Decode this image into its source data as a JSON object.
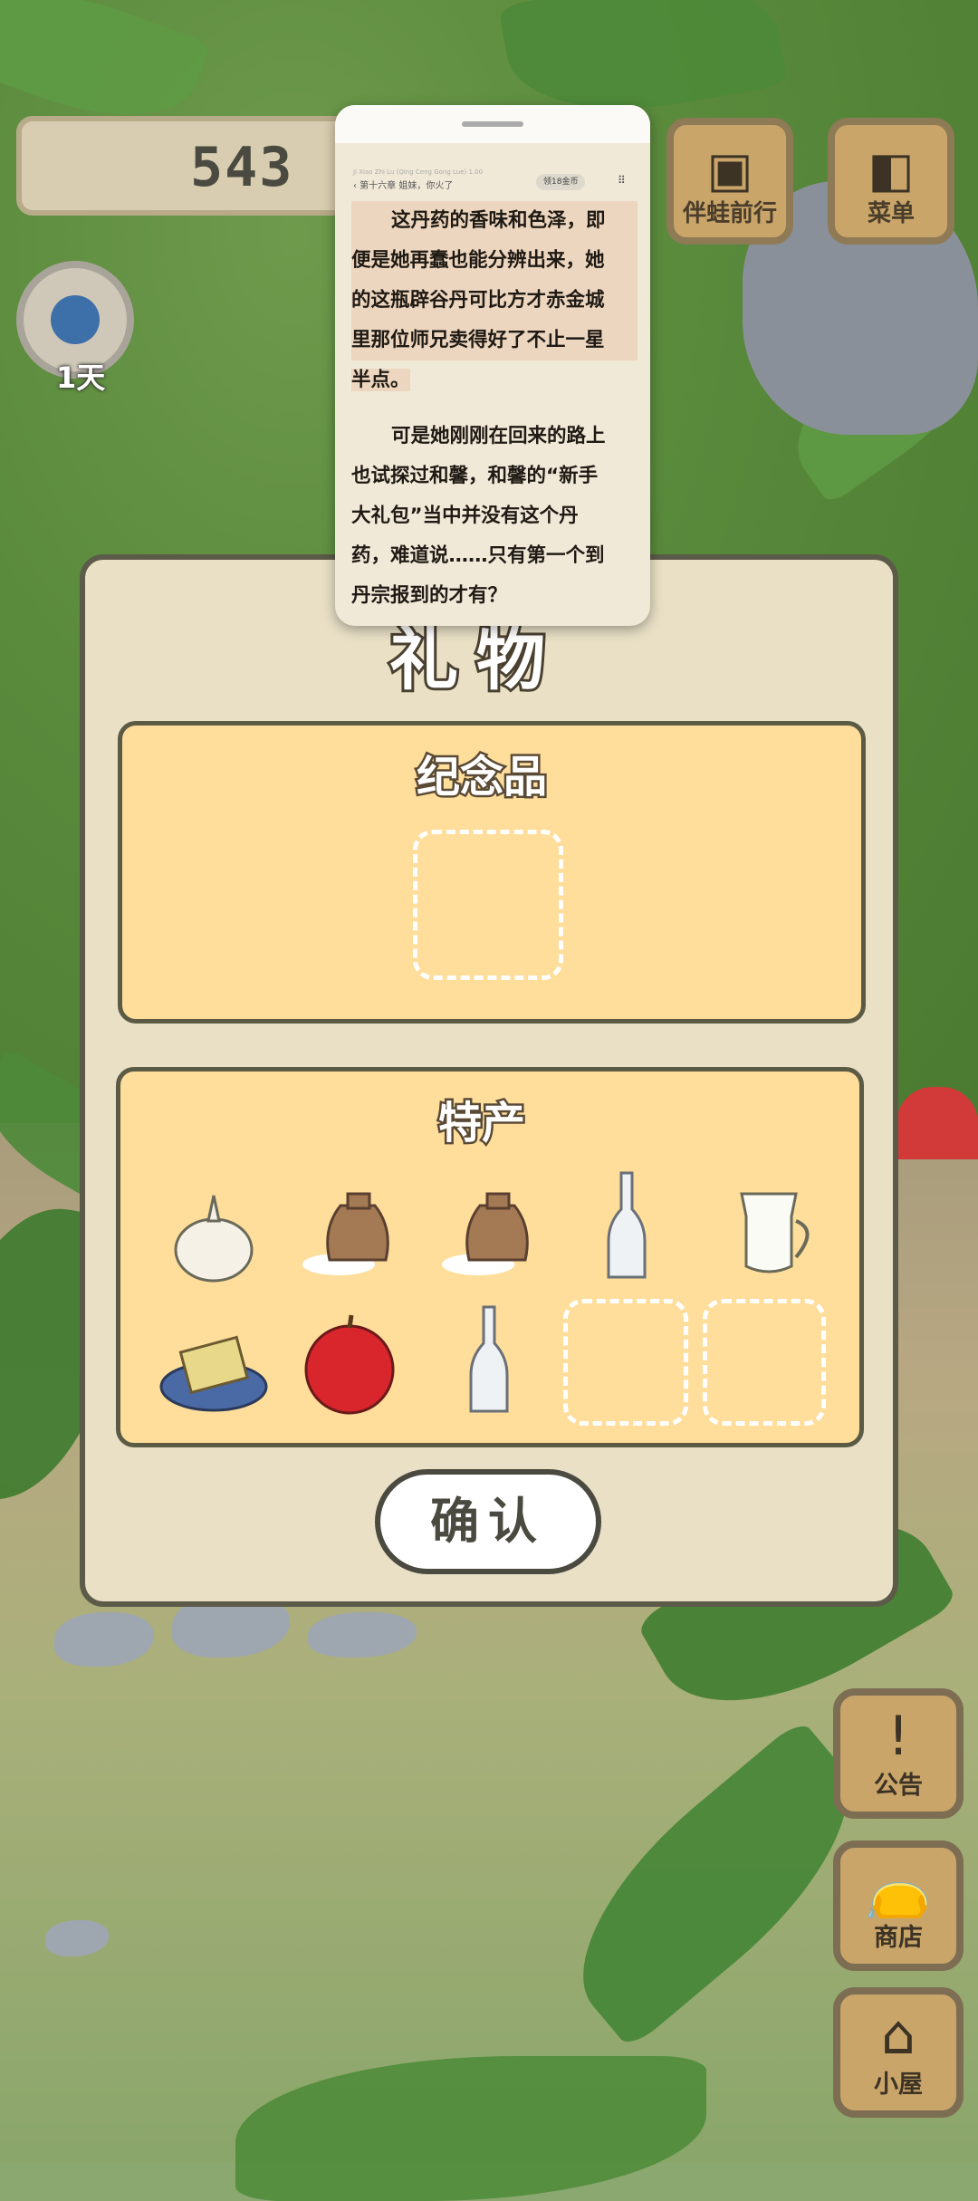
{
  "hud": {
    "clover_count": "543",
    "day_label": "1天",
    "travel_button": "伴蛙前行",
    "menu_button": "菜单"
  },
  "reader": {
    "tiny_header": "Ji Xiao Zhi Lu (Qing Ceng Gong Lue) 1.00",
    "chapter": "‹ 第十六章 姐妹，你火了",
    "badge": "领18金币",
    "para1_lines": [
      "这丹药的香味和色泽，即",
      "便是她再蠢也能分辨出来，她",
      "的这瓶辟谷丹可比方才赤金城",
      "里那位师兄卖得好了不止一星",
      "半点。"
    ],
    "para2_lines": [
      "可是她刚刚在回来的路上",
      "也试探过和馨，和馨的“新手",
      "大礼包”当中并没有这个丹",
      "药，难道说……只有第一个到",
      "丹宗报到的才有？"
    ]
  },
  "gift": {
    "title": "礼物",
    "souvenir_title": "纪念品",
    "specialty_title": "特产",
    "items": [
      "garlic",
      "rice-bag",
      "rice-bag",
      "glass-bottle",
      "milk-jug",
      "butter-plate",
      "apple",
      "glass-bottle",
      "empty",
      "empty"
    ],
    "confirm": "确认"
  },
  "side": {
    "notice": "公告",
    "shop": "商店",
    "house": "小屋"
  }
}
